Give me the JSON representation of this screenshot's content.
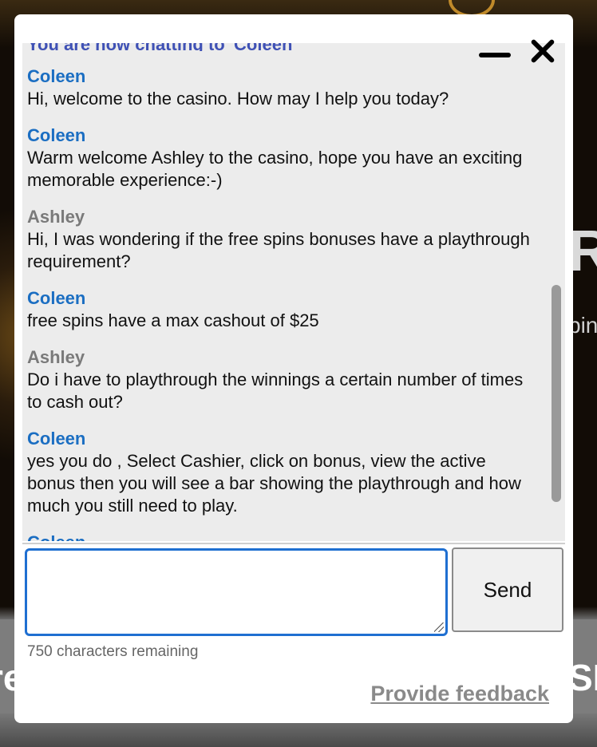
{
  "background": {
    "left_big_text": "re",
    "right_big_text": "SIT",
    "right_mid_letter": "R",
    "right_small_text": "pin"
  },
  "chat": {
    "status_text": "You are now chatting to 'Coleen'",
    "messages": [
      {
        "sender": "Coleen",
        "role": "agent",
        "text": "Hi, welcome to the casino. How may I help you today?"
      },
      {
        "sender": "Coleen",
        "role": "agent",
        "text": "Warm welcome Ashley to the casino, hope you have an exciting memorable experience:-)"
      },
      {
        "sender": "Ashley",
        "role": "user",
        "text": "Hi, I was wondering if the free spins bonuses have a playthrough requirement?"
      },
      {
        "sender": "Coleen",
        "role": "agent",
        "text": "free spins have a max cashout of $25"
      },
      {
        "sender": "Ashley",
        "role": "user",
        "text": "Do i have to playthrough the winnings a certain number of times to cash out?"
      },
      {
        "sender": "Coleen",
        "role": "agent",
        "text": "yes you do , Select Cashier, click on bonus, view the active bonus then you will see a bar showing the playthrough and how much you still need to play."
      },
      {
        "sender": "Coleen",
        "role": "agent",
        "text": ""
      }
    ],
    "input": {
      "value": "",
      "placeholder": ""
    },
    "send_label": "Send",
    "chars_remaining": "750 characters remaining",
    "feedback_label": "Provide feedback"
  },
  "colors": {
    "agent_name": "#1b6ec2",
    "user_name": "#7a7a7a",
    "status": "#3f51b5",
    "input_border": "#1f6fd1"
  }
}
